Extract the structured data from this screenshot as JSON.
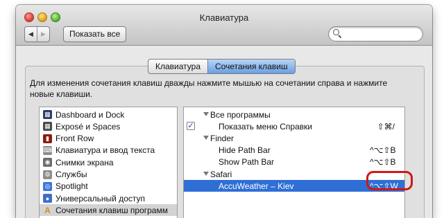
{
  "window": {
    "title": "Клавиатура"
  },
  "toolbar": {
    "back_icon": "◀",
    "forward_icon": "▶",
    "show_all_label": "Показать все",
    "search": {
      "placeholder": ""
    }
  },
  "tabs": [
    {
      "label": "Клавиатура",
      "active": false
    },
    {
      "label": "Сочетания клавиш",
      "active": true
    }
  ],
  "description": "Для изменения сочетания клавиш дважды нажмите мышью на сочетании справа и нажмите новые клавиши.",
  "categories": [
    {
      "label": "Dashboard и Dock",
      "icon": "dashboard-icon",
      "color": "#2a3e6a",
      "glyph": "▦"
    },
    {
      "label": "Exposé и Spaces",
      "icon": "expose-icon",
      "color": "#4a4a4a",
      "glyph": "▦"
    },
    {
      "label": "Front Row",
      "icon": "front-row-icon",
      "color": "#8a1d14",
      "glyph": "▮"
    },
    {
      "label": "Клавиатура и ввод текста",
      "icon": "keyboard-icon",
      "color": "#8e8e8e",
      "glyph": "⌨"
    },
    {
      "label": "Снимки экрана",
      "icon": "screenshot-icon",
      "color": "#6d6d6d",
      "glyph": "◉"
    },
    {
      "label": "Службы",
      "icon": "services-icon",
      "color": "#8e8e8e",
      "glyph": "⚙"
    },
    {
      "label": "Spotlight",
      "icon": "spotlight-icon",
      "color": "#3b78d8",
      "glyph": "◎"
    },
    {
      "label": "Универсальный доступ",
      "icon": "accessibility-icon",
      "color": "#3f6fc9",
      "glyph": "●"
    },
    {
      "label": "Сочетания клавиш программ",
      "icon": "app-shortcuts-icon",
      "color": "#c8941c",
      "glyph": "A"
    }
  ],
  "shortcuts": [
    {
      "label": "Все программы",
      "group": true,
      "checkbox": false,
      "shortcut": ""
    },
    {
      "label": "Показать меню Справки",
      "group": false,
      "checkbox": true,
      "shortcut": "⇧⌘/"
    },
    {
      "label": "Finder",
      "group": true,
      "checkbox": false,
      "shortcut": ""
    },
    {
      "label": "Hide Path Bar",
      "group": false,
      "checkbox": false,
      "shortcut": "^⌥⇧B"
    },
    {
      "label": "Show Path Bar",
      "group": false,
      "checkbox": false,
      "shortcut": "^⌥⇧B"
    },
    {
      "label": "Safari",
      "group": true,
      "checkbox": false,
      "shortcut": ""
    },
    {
      "label": "AccuWeather – Kiev",
      "group": false,
      "checkbox": false,
      "shortcut": "^⌥⇧W",
      "selected": true
    }
  ],
  "checkmark": "✓"
}
